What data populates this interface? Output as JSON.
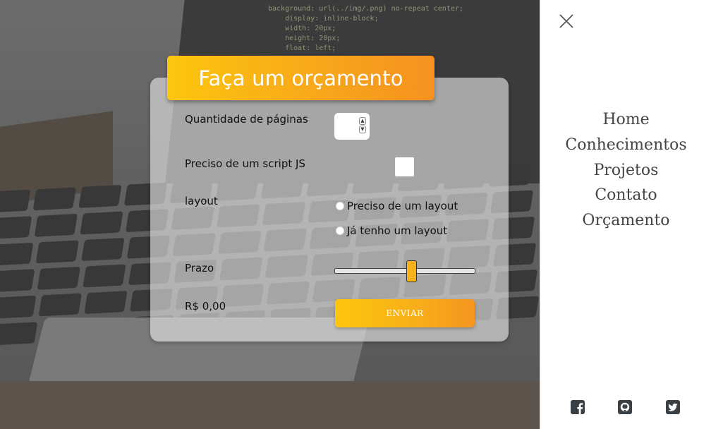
{
  "form": {
    "title": "Faça um orçamento",
    "pages_label": "Quantidade de páginas",
    "pages_value": "",
    "script_label": "Preciso de um script JS",
    "script_checked": false,
    "layout_label": "layout",
    "layout_options": [
      "Preciso de um layout",
      "Já tenho um layout"
    ],
    "prazo_label": "Prazo",
    "prazo_level": 0.55,
    "price": "R$ 0,00",
    "submit_label": "ENVIAR"
  },
  "menu": {
    "items": [
      "Home",
      "Conhecimentos",
      "Projetos",
      "Contato",
      "Orçamento"
    ]
  },
  "social": {
    "icons": [
      "facebook-icon",
      "github-icon",
      "twitter-icon"
    ]
  },
  "colors": {
    "accent_start": "#fdc60e",
    "accent_end": "#f59120",
    "menu_text": "#444444"
  }
}
